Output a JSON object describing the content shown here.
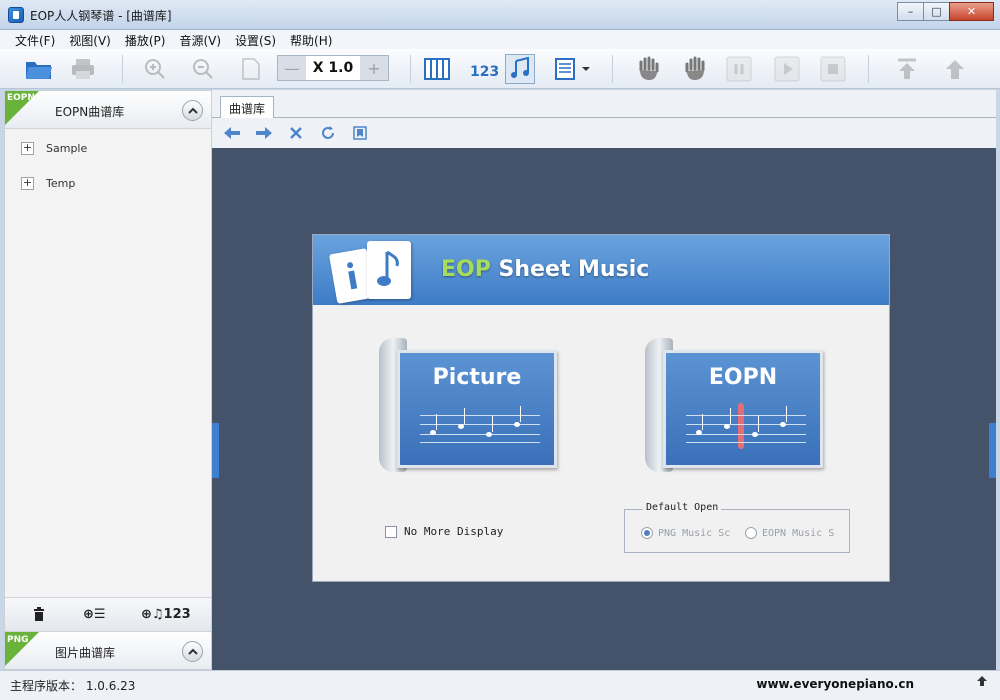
{
  "window": {
    "title": "EOP人人钢琴谱 - [曲谱库]"
  },
  "menu": [
    "文件(F)",
    "视图(V)",
    "播放(P)",
    "音源(V)",
    "设置(S)",
    "帮助(H)"
  ],
  "toolbar": {
    "zoom_minus": "—",
    "zoom_value": "X 1.0",
    "zoom_plus": "+",
    "icons": [
      "folder-open-icon",
      "print-icon",
      "zoom-in-icon",
      "zoom-out-icon",
      "fit-page-icon",
      "piano-keys-icon",
      "numbered-notation-icon",
      "staff-notation-icon",
      "layout-icon",
      "left-hand-icon",
      "right-hand-icon",
      "pause-icon",
      "play-icon",
      "stop-icon",
      "top-icon",
      "up-icon"
    ]
  },
  "left_panel": {
    "badge": "EOPN",
    "title": "EOPN曲谱库",
    "items": [
      "Sample",
      "Temp"
    ],
    "footer": {
      "add_list": "⊕☰",
      "add_score": "⊕♫123"
    },
    "badge2": "PNG",
    "title2": "图片曲谱库"
  },
  "content": {
    "tab": "曲谱库"
  },
  "dialog": {
    "title_eop": "EOP",
    "title_rest": " Sheet Music",
    "choice1": "Picture",
    "choice2": "EOPN",
    "no_more": "No More Display",
    "default_open": "Default Open",
    "opt1": "PNG Music Sc",
    "opt2": "EOPN Music S"
  },
  "status": {
    "version": "主程序版本： 1.0.6.23",
    "site": "www.everyonepiano.cn"
  },
  "colors": {
    "accent": "#3e7cc6",
    "green_tag": "#69b33a",
    "stage": "#44526a"
  }
}
